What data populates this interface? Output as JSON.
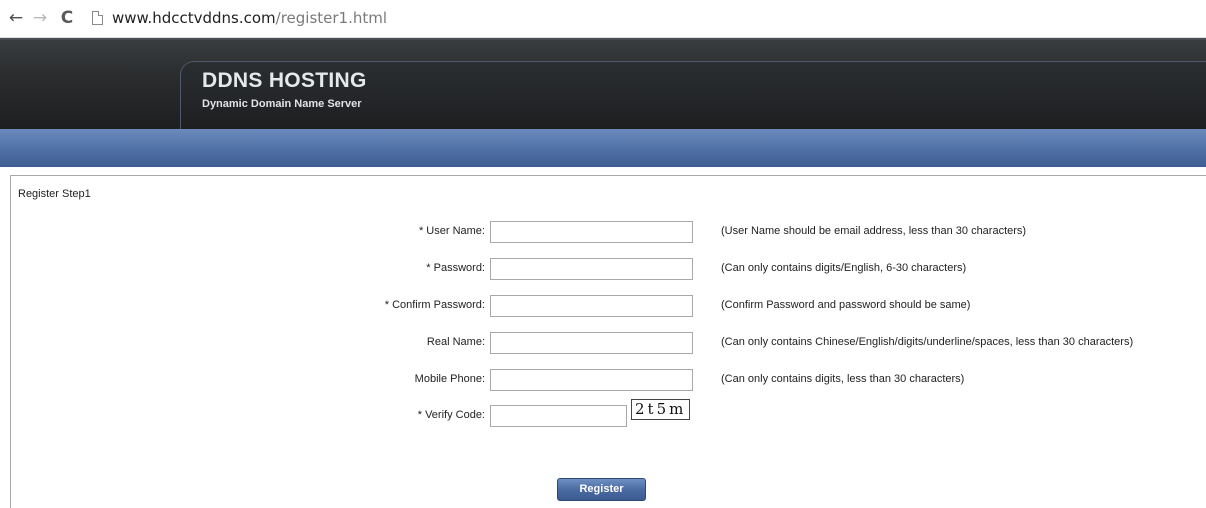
{
  "browser": {
    "back_icon": "←",
    "forward_icon": "→",
    "reload_icon": "C",
    "url_host": "www.hdcctvddns.com",
    "url_path": "/register1.html"
  },
  "header": {
    "title": "DDNS HOSTING",
    "subtitle": "Dynamic Domain Name Server"
  },
  "colors": {
    "header_dark": "#1e1f21",
    "nav_blue": "#4f70a4",
    "button_blue": "#4a6ba3"
  },
  "form": {
    "step_title": "Register Step1",
    "fields": [
      {
        "label": "* User Name:",
        "value": "",
        "hint": "(User Name should be email address, less than 30 characters)"
      },
      {
        "label": "* Password:",
        "value": "",
        "hint": "(Can only contains digits/English, 6-30 characters)"
      },
      {
        "label": "* Confirm Password:",
        "value": "",
        "hint": "(Confirm Password and password should be same)"
      },
      {
        "label": "Real Name:",
        "value": "",
        "hint": "(Can only contains Chinese/English/digits/underline/spaces, less than 30 characters)"
      },
      {
        "label": "Mobile Phone:",
        "value": "",
        "hint": "(Can only contains digits, less than 30 characters)"
      },
      {
        "label": "* Verify Code:",
        "value": ""
      }
    ],
    "captcha_text": "2t5m",
    "register_label": "Register"
  }
}
